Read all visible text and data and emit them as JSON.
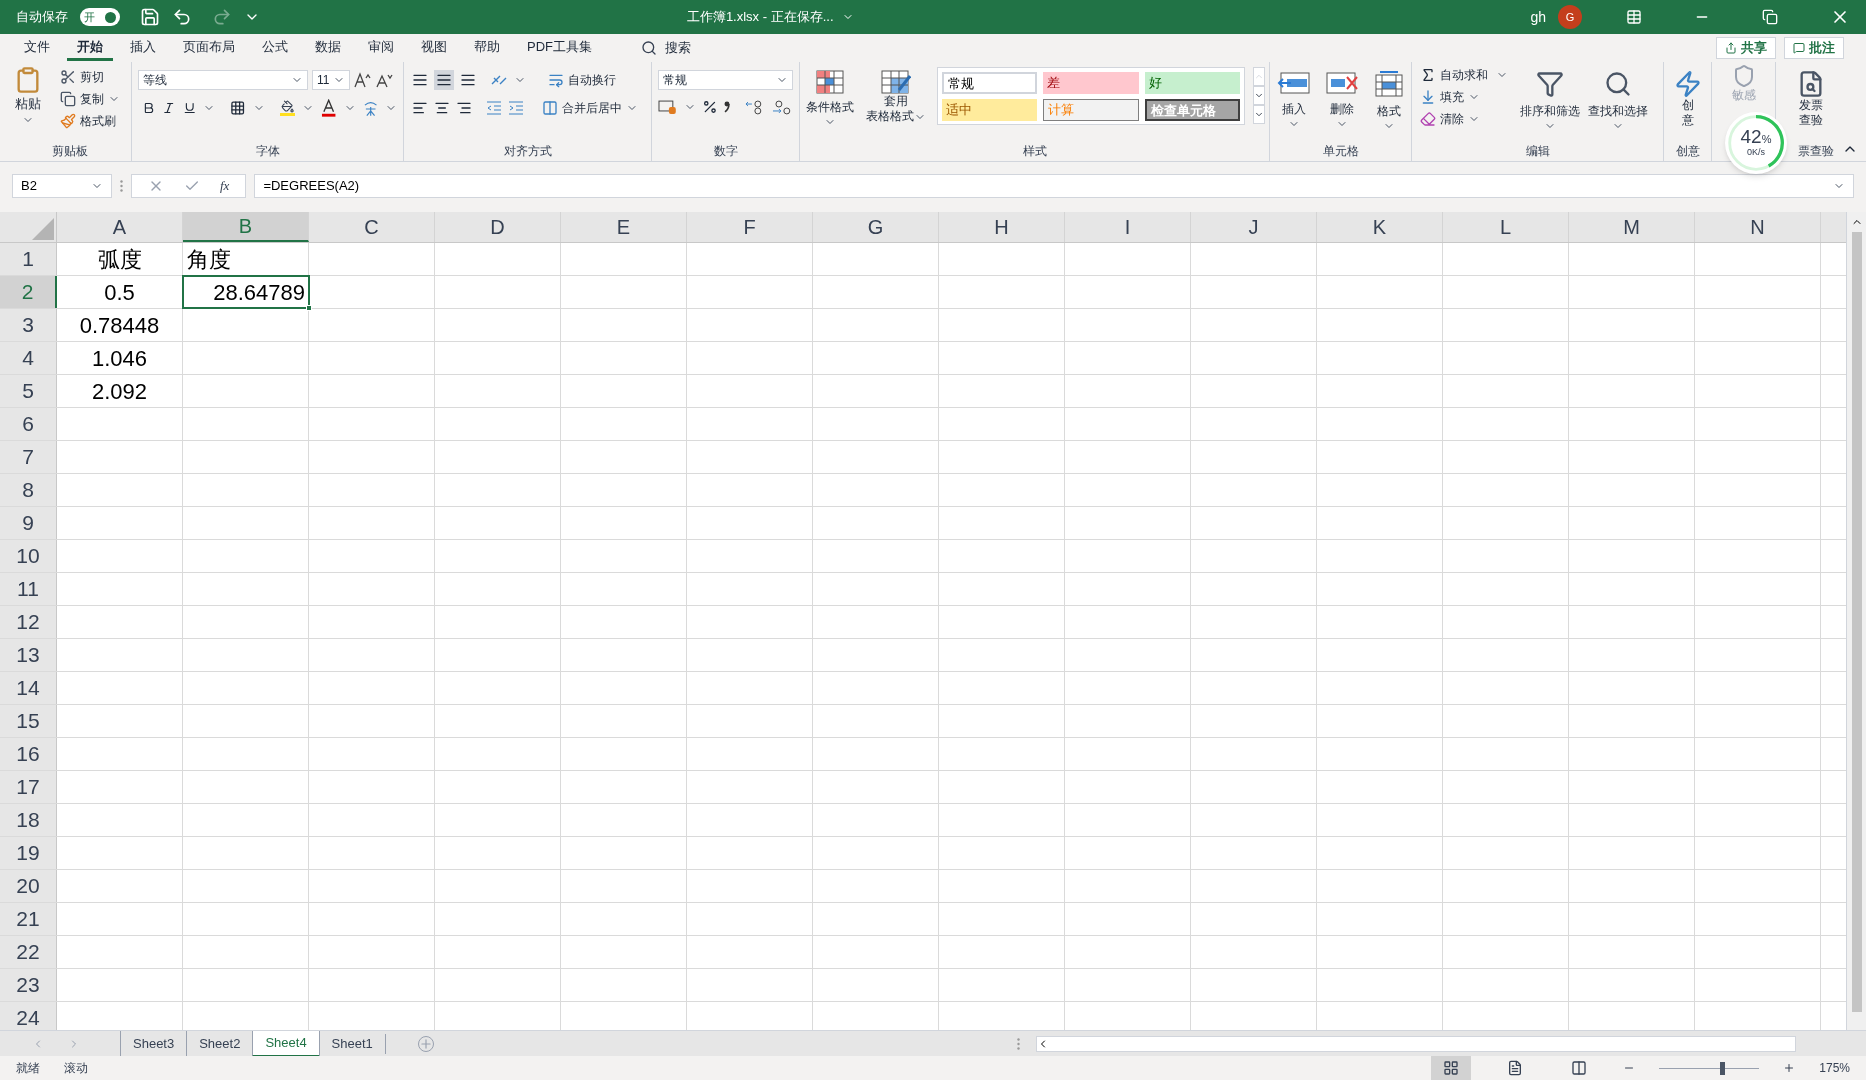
{
  "title_bar": {
    "autosave_label": "自动保存",
    "autosave_toggle": {
      "label": "开",
      "on": true
    },
    "title": "工作簿1.xlsx - 正在保存...",
    "user": "gh",
    "avatar": "G"
  },
  "menu_tabs": [
    {
      "label": "文件",
      "selected": false
    },
    {
      "label": "开始",
      "selected": true
    },
    {
      "label": "插入",
      "selected": false
    },
    {
      "label": "页面布局",
      "selected": false
    },
    {
      "label": "公式",
      "selected": false
    },
    {
      "label": "数据",
      "selected": false
    },
    {
      "label": "审阅",
      "selected": false
    },
    {
      "label": "视图",
      "selected": false
    },
    {
      "label": "帮助",
      "selected": false
    },
    {
      "label": "PDF工具集",
      "selected": false
    }
  ],
  "search": "搜索",
  "share": "共享",
  "comments": "批注",
  "ribbon": {
    "clipboard": {
      "paste": "粘贴",
      "cut": "剪切",
      "copy": "复制",
      "format_painter": "格式刷",
      "label": "剪贴板"
    },
    "font": {
      "font_name": "等线",
      "font_size": "11",
      "label": "字体"
    },
    "alignment": {
      "wrap": "自动换行",
      "merge": "合并后居中",
      "label": "对齐方式"
    },
    "number": {
      "format": "常规",
      "label": "数字"
    },
    "styles": {
      "conditional": "条件格式",
      "table_format": [
        "套用",
        "表格格式"
      ],
      "label": "样式",
      "cell_styles": [
        {
          "label": "常规",
          "kind": "normal"
        },
        {
          "label": "差",
          "kind": "bad"
        },
        {
          "label": "好",
          "kind": "good"
        },
        {
          "label": "适中",
          "kind": "neutral"
        },
        {
          "label": "计算",
          "kind": "calc"
        },
        {
          "label": "检查单元格",
          "kind": "check"
        }
      ]
    },
    "cells": {
      "buttons": [
        {
          "label": "插入",
          "kind": "insert"
        },
        {
          "label": "删除",
          "kind": "delete"
        },
        {
          "label": "格式",
          "kind": "format"
        }
      ],
      "label": "单元格"
    },
    "editing": {
      "autosum": "自动求和",
      "fill": "填充",
      "clear": "清除",
      "sort": "排序和筛选",
      "find": "查找和选择",
      "label": "编辑"
    },
    "ideas": {
      "button": [
        "创",
        "意"
      ],
      "label": "创意"
    },
    "sensitivity": {
      "button": "敏感",
      "disabled": true
    },
    "invoice": {
      "button": [
        "发票",
        "查验"
      ],
      "label": "票查验"
    }
  },
  "speed_widget": {
    "percent": "42",
    "unit": "%",
    "speed": "0K/s",
    "level": 0.42
  },
  "formula_bar": {
    "name_box": "B2",
    "function_label": "fx",
    "formula": "=DEGREES(A2)"
  },
  "columns": [
    {
      "label": "A",
      "selected": false
    },
    {
      "label": "B",
      "selected": true
    },
    {
      "label": "C",
      "selected": false
    },
    {
      "label": "D",
      "selected": false
    },
    {
      "label": "E",
      "selected": false
    },
    {
      "label": "F",
      "selected": false
    },
    {
      "label": "G",
      "selected": false
    },
    {
      "label": "H",
      "selected": false
    },
    {
      "label": "I",
      "selected": false
    },
    {
      "label": "J",
      "selected": false
    },
    {
      "label": "K",
      "selected": false
    },
    {
      "label": "L",
      "selected": false
    },
    {
      "label": "M",
      "selected": false
    },
    {
      "label": "N",
      "selected": false
    }
  ],
  "rows": [
    {
      "label": "1",
      "selected": false,
      "cells": [
        {
          "text": "弧度",
          "centered": true
        },
        {
          "text": "角度",
          "kind": "text",
          "centered": false
        }
      ]
    },
    {
      "label": "2",
      "selected": true,
      "cells": [
        {
          "text": "0.5",
          "centered": true
        },
        {
          "text": "28.64789",
          "kind": "number",
          "centered": false,
          "active": true
        }
      ]
    },
    {
      "label": "3",
      "selected": false,
      "cells": [
        {
          "text": "0.78448",
          "centered": true
        }
      ]
    },
    {
      "label": "4",
      "selected": false,
      "cells": [
        {
          "text": "1.046",
          "centered": true
        }
      ]
    },
    {
      "label": "5",
      "selected": false,
      "cells": [
        {
          "text": "2.092",
          "centered": true
        }
      ]
    },
    {
      "label": "6",
      "selected": false,
      "cells": []
    },
    {
      "label": "7",
      "selected": false,
      "cells": []
    },
    {
      "label": "8",
      "selected": false,
      "cells": []
    },
    {
      "label": "9",
      "selected": false,
      "cells": []
    },
    {
      "label": "10",
      "selected": false,
      "cells": []
    },
    {
      "label": "11",
      "selected": false,
      "cells": []
    },
    {
      "label": "12",
      "selected": false,
      "cells": []
    },
    {
      "label": "13",
      "selected": false,
      "cells": []
    },
    {
      "label": "14",
      "selected": false,
      "cells": []
    },
    {
      "label": "15",
      "selected": false,
      "cells": []
    },
    {
      "label": "16",
      "selected": false,
      "cells": []
    },
    {
      "label": "17",
      "selected": false,
      "cells": []
    },
    {
      "label": "18",
      "selected": false,
      "cells": []
    },
    {
      "label": "19",
      "selected": false,
      "cells": []
    },
    {
      "label": "20",
      "selected": false,
      "cells": []
    },
    {
      "label": "21",
      "selected": false,
      "cells": []
    },
    {
      "label": "22",
      "selected": false,
      "cells": []
    },
    {
      "label": "23",
      "selected": false,
      "cells": []
    },
    {
      "label": "24",
      "selected": false,
      "cells": []
    }
  ],
  "sheet_tabs": [
    {
      "label": "Sheet3",
      "selected": false
    },
    {
      "label": "Sheet2",
      "selected": false
    },
    {
      "label": "Sheet4",
      "selected": true
    },
    {
      "label": "Sheet1",
      "selected": false
    }
  ],
  "status_bar": {
    "items": [
      "就绪",
      "滚动"
    ],
    "views": [
      {
        "kind": "normal",
        "selected": true
      },
      {
        "kind": "page_layout",
        "selected": false
      },
      {
        "kind": "page_break",
        "selected": false
      }
    ],
    "zoom": {
      "level": 0.63,
      "label": "175%"
    }
  }
}
